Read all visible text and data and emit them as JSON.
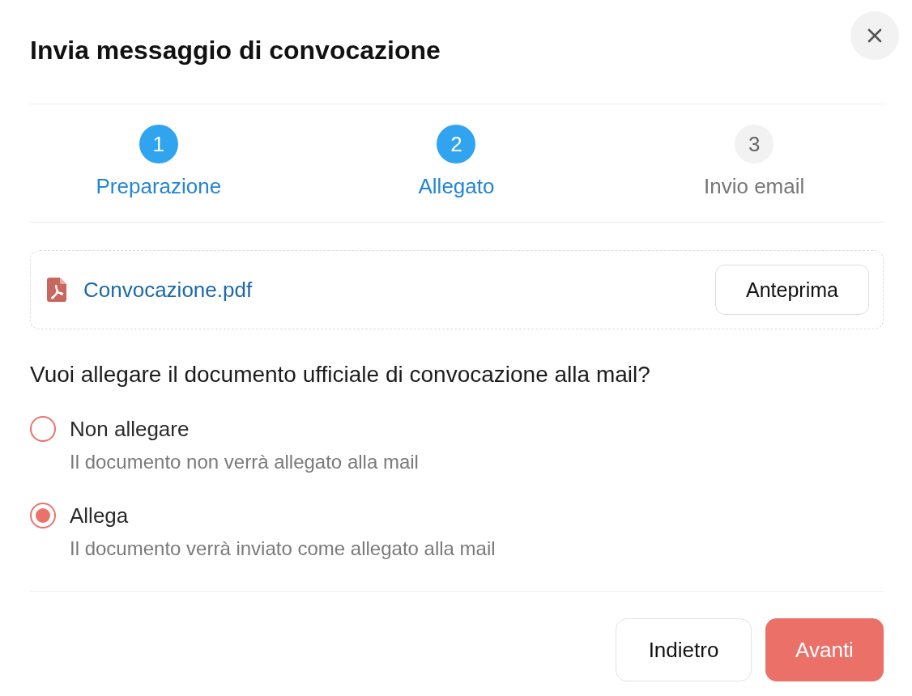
{
  "dialog": {
    "title": "Invia messaggio di convocazione"
  },
  "steps": [
    {
      "number": "1",
      "label": "Preparazione",
      "active": true
    },
    {
      "number": "2",
      "label": "Allegato",
      "active": true
    },
    {
      "number": "3",
      "label": "Invio email",
      "active": false
    }
  ],
  "attachment": {
    "file_name": "Convocazione.pdf",
    "preview_button": "Anteprima"
  },
  "question": "Vuoi allegare il documento ufficiale di convocazione alla mail?",
  "options": [
    {
      "label": "Non allegare",
      "description": "Il documento non verrà allegato alla mail",
      "selected": false
    },
    {
      "label": "Allega",
      "description": "Il documento verrà inviato come allegato alla mail",
      "selected": true
    }
  ],
  "footer": {
    "buttons": [
      {
        "label": "Indietro",
        "kind": "secondary"
      },
      {
        "label": "Avanti",
        "kind": "primary"
      }
    ]
  }
}
